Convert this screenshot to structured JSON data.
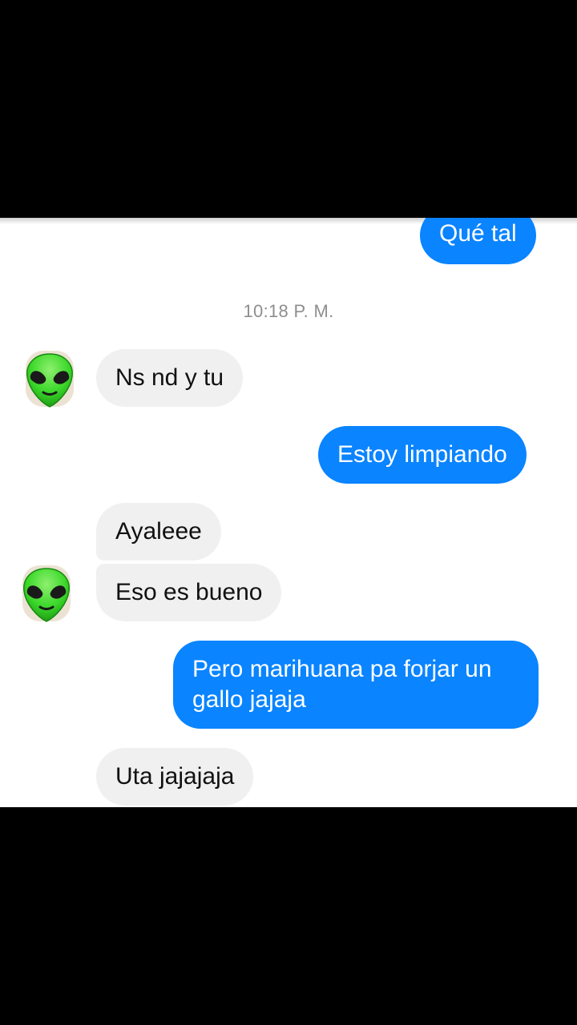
{
  "colors": {
    "outgoing_bubble": "#0a84ff",
    "incoming_bubble": "#f0f0f0",
    "timestamp_text": "#8e8e8e",
    "avatar_alien": "#3bd82a"
  },
  "conversation": {
    "timestamp": "10:18 P. M.",
    "messages": [
      {
        "direction": "outgoing",
        "text": "Qué tal"
      },
      {
        "direction": "incoming",
        "text": "Ns nd y tu"
      },
      {
        "direction": "outgoing",
        "text": "Estoy limpiando"
      },
      {
        "direction": "incoming",
        "text": "Ayaleee"
      },
      {
        "direction": "incoming",
        "text": "Eso es bueno"
      },
      {
        "direction": "outgoing",
        "text": "Pero marihuana pa forjar un gallo jajaja"
      },
      {
        "direction": "incoming",
        "text": "Uta jajajaja"
      }
    ]
  },
  "avatar": {
    "icon": "alien-face-icon"
  }
}
